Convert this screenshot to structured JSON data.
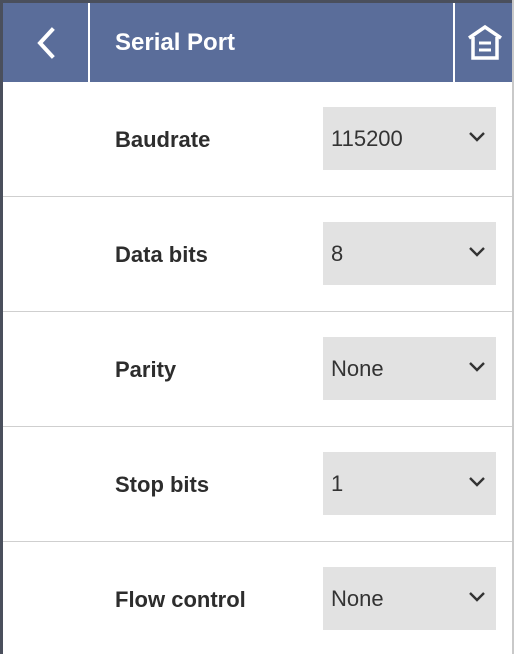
{
  "header": {
    "title": "Serial Port",
    "back_icon": "chevron-left-icon",
    "home_icon": "home-icon",
    "background_color": "#5a6d9a"
  },
  "settings": [
    {
      "label": "Baudrate",
      "value": "115200"
    },
    {
      "label": "Data bits",
      "value": "8"
    },
    {
      "label": "Parity",
      "value": "None"
    },
    {
      "label": "Stop bits",
      "value": "1"
    },
    {
      "label": "Flow control",
      "value": "None"
    }
  ],
  "colors": {
    "select_background": "#e2e2e2",
    "divider": "#cfcfcf",
    "label_text": "#2d2d2d"
  }
}
